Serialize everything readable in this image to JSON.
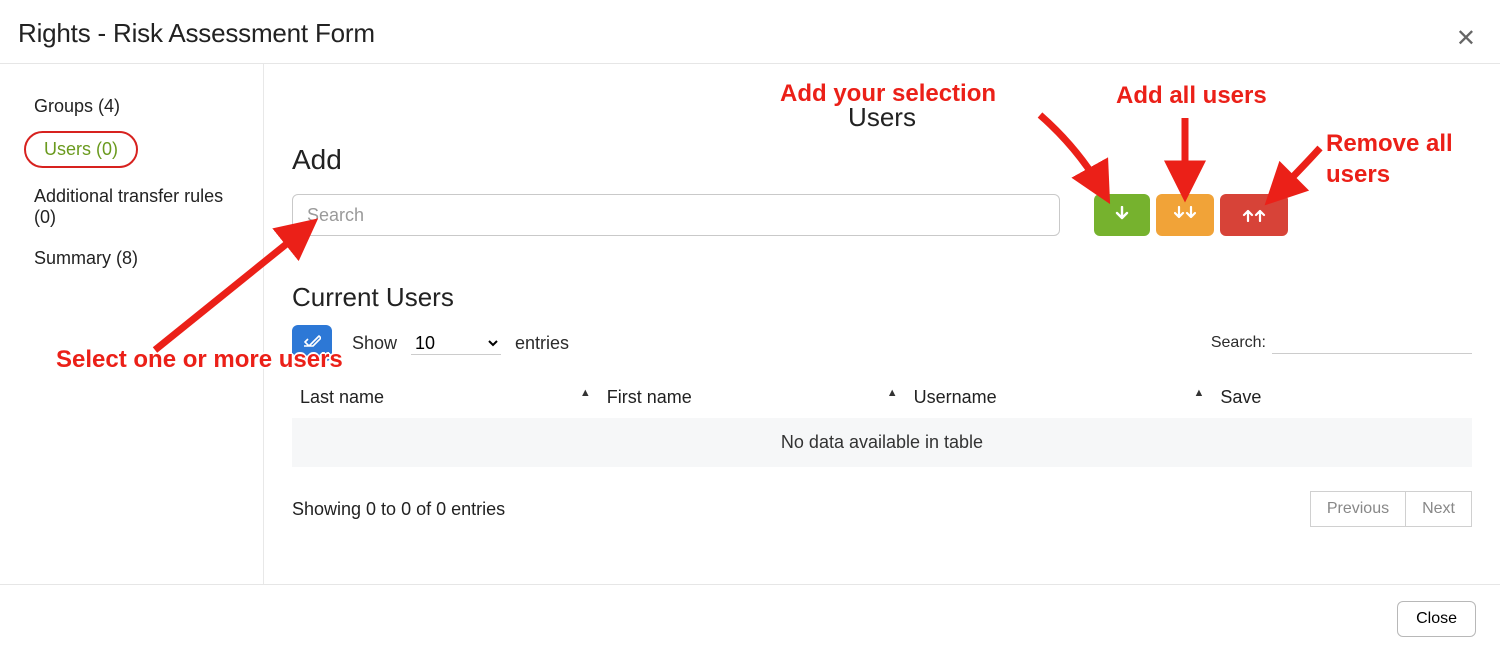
{
  "header": {
    "title": "Rights - Risk Assessment Form"
  },
  "sidebar": {
    "items": [
      {
        "label": "Groups (4)"
      },
      {
        "label": "Users (0)"
      },
      {
        "label": "Additional transfer rules (0)"
      },
      {
        "label": "Summary (8)"
      }
    ]
  },
  "main": {
    "page_title": "Users",
    "add_section_heading": "Add",
    "search_placeholder": "Search",
    "current_users_heading": "Current Users",
    "show_label": "Show",
    "show_value": "10",
    "entries_label": "entries",
    "search_label": "Search:",
    "columns": {
      "last_name": "Last name",
      "first_name": "First name",
      "username": "Username",
      "save": "Save"
    },
    "empty_text": "No data available in table",
    "info_text": "Showing 0 to 0 of 0 entries",
    "pager": {
      "previous": "Previous",
      "next": "Next"
    }
  },
  "footer": {
    "close": "Close"
  },
  "annotations": {
    "select_users": "Select one or more users",
    "add_selection": "Add your selection",
    "add_all": "Add all users",
    "remove_all": "Remove all users"
  },
  "colors": {
    "accent_red": "#eb2018",
    "btn_green": "#76b22e",
    "btn_orange": "#f1a338",
    "btn_red": "#d74338",
    "eraser_blue": "#2d78d6",
    "sidebar_active": "#6a9a1e"
  }
}
